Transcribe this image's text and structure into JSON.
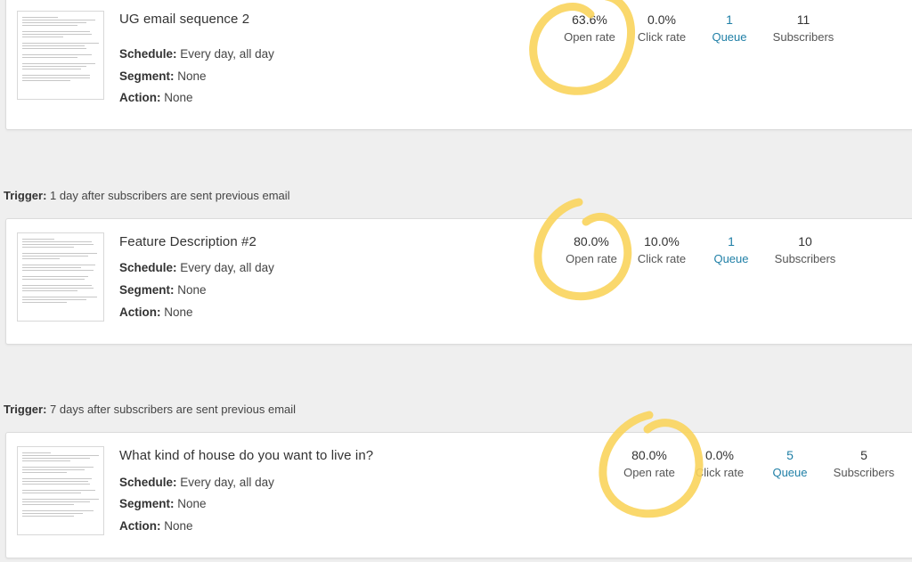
{
  "emails": [
    {
      "title": "UG email sequence 2",
      "schedule_label": "Schedule:",
      "schedule_value": "Every day, all day",
      "segment_label": "Segment:",
      "segment_value": "None",
      "action_label": "Action:",
      "action_value": "None",
      "open_rate": "63.6%",
      "open_label": "Open rate",
      "click_rate": "0.0%",
      "click_label": "Click rate",
      "queue": "1",
      "queue_label": "Queue",
      "subscribers": "11",
      "subscribers_label": "Subscribers"
    },
    {
      "title": "Feature Description #2",
      "schedule_label": "Schedule:",
      "schedule_value": "Every day, all day",
      "segment_label": "Segment:",
      "segment_value": "None",
      "action_label": "Action:",
      "action_value": "None",
      "open_rate": "80.0%",
      "open_label": "Open rate",
      "click_rate": "10.0%",
      "click_label": "Click rate",
      "queue": "1",
      "queue_label": "Queue",
      "subscribers": "10",
      "subscribers_label": "Subscribers"
    },
    {
      "title": "What kind of house do you want to live in?",
      "schedule_label": "Schedule:",
      "schedule_value": "Every day, all day",
      "segment_label": "Segment:",
      "segment_value": "None",
      "action_label": "Action:",
      "action_value": "None",
      "open_rate": "80.0%",
      "open_label": "Open rate",
      "click_rate": "0.0%",
      "click_label": "Click rate",
      "queue": "5",
      "queue_label": "Queue",
      "subscribers": "5",
      "subscribers_label": "Subscribers"
    }
  ],
  "triggers": [
    {
      "label": "Trigger:",
      "text": "1 day after subscribers are sent previous email"
    },
    {
      "label": "Trigger:",
      "text": "7 days after subscribers are sent previous email"
    }
  ],
  "colors": {
    "highlight": "#f9d45c",
    "link": "#1f7fa6"
  }
}
